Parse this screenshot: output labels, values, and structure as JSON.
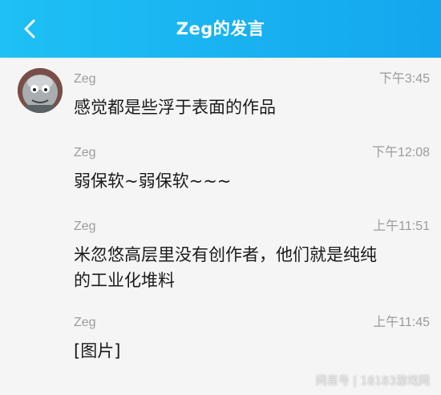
{
  "header": {
    "title": "Zeg的发言",
    "background": "#19b3f2"
  },
  "messages": [
    {
      "name": "Zeg",
      "time": "下午3:45",
      "text": "感觉都是些浮于表面的作品"
    },
    {
      "name": "Zeg",
      "time": "下午12:08",
      "text": "弱保软~弱保软~~~"
    },
    {
      "name": "Zeg",
      "time": "上午11:51",
      "text": "米忽悠高层里没有创作者，他们就是纯纯\n的工业化堆料"
    },
    {
      "name": "Zeg",
      "time": "上午11:45",
      "text": "[图片]"
    }
  ],
  "watermark": "网易号 | 18183游戏网"
}
